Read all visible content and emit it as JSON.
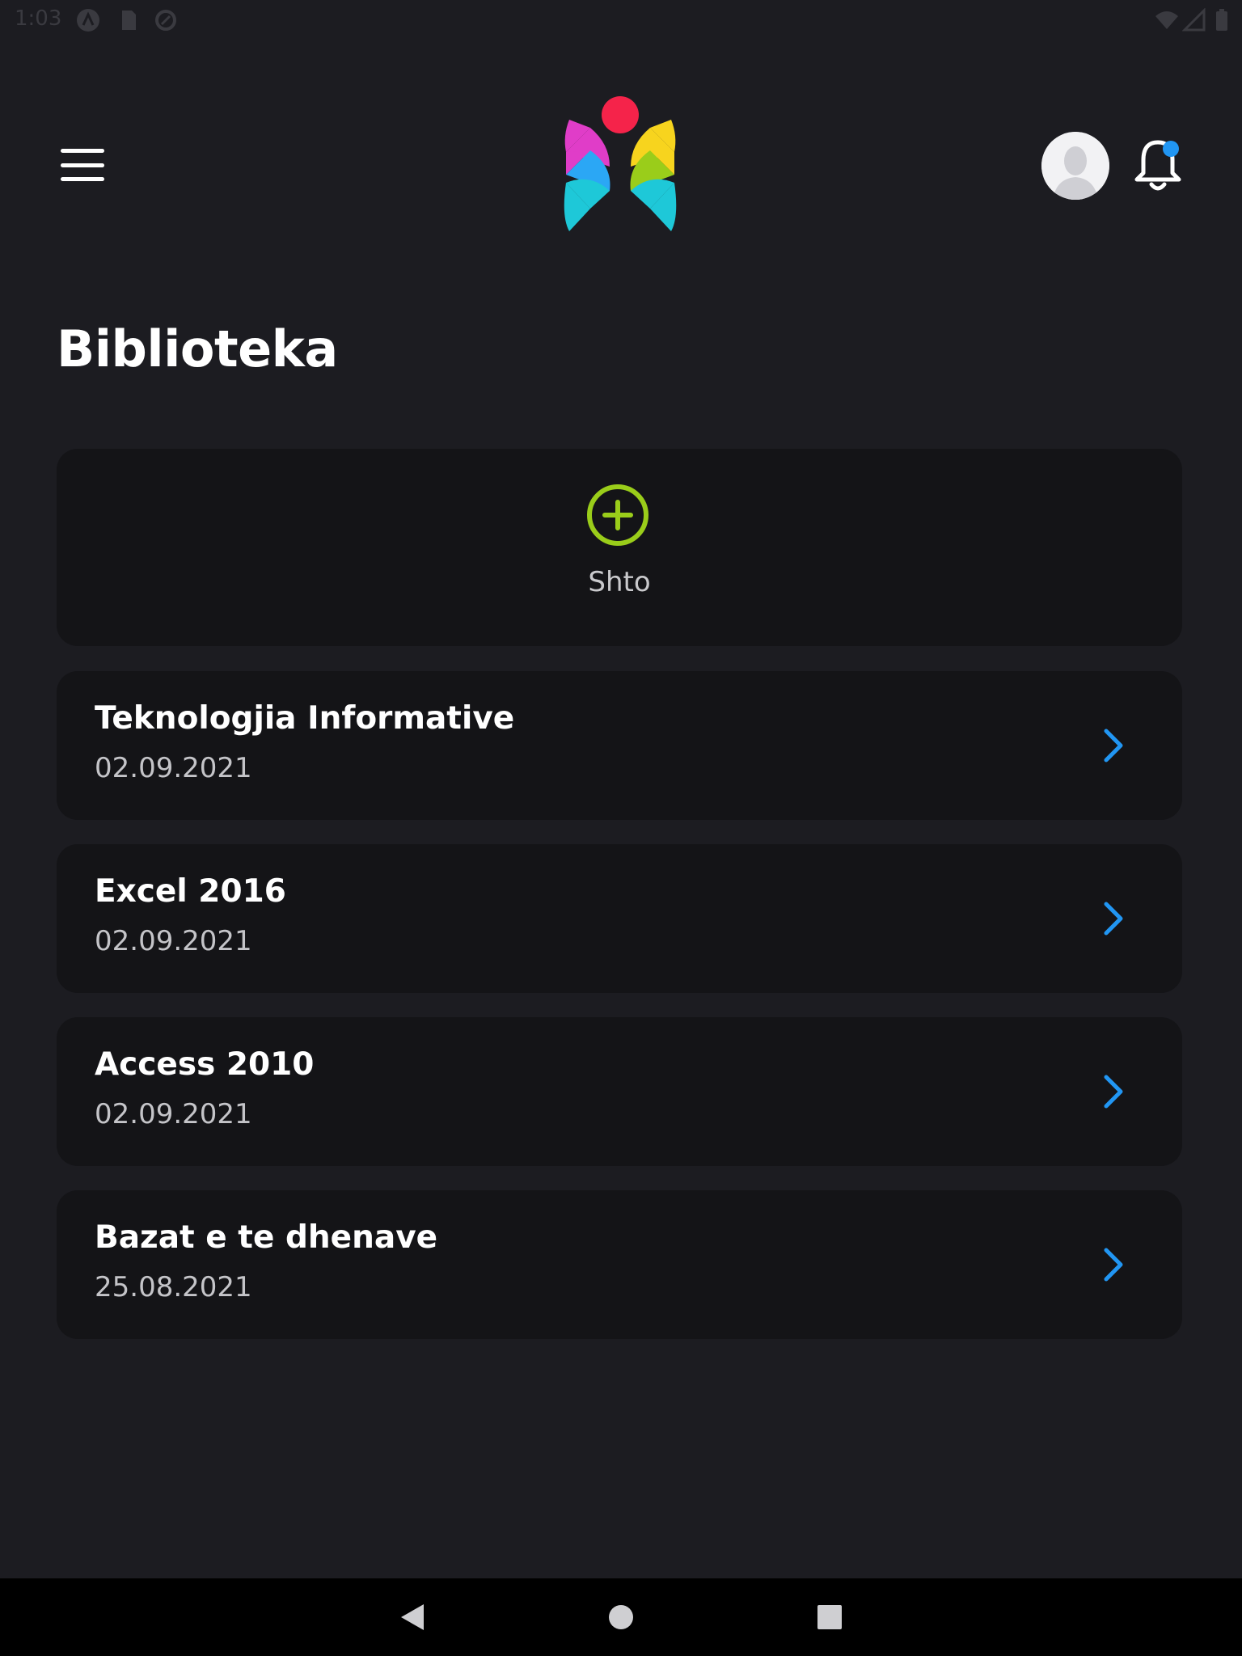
{
  "status_bar": {
    "time": "1:03",
    "icons": [
      "android-debug-icon",
      "sd-card-icon",
      "sync-icon",
      "wifi-icon",
      "signal-icon",
      "battery-icon"
    ]
  },
  "header": {
    "menu_icon": "hamburger-menu-icon",
    "logo": "app-logo",
    "avatar_icon": "user-avatar-icon",
    "notification_icon": "bell-icon",
    "notification_badge_color": "#2196f3"
  },
  "page": {
    "title": "Biblioteka"
  },
  "add_card": {
    "label": "Shto",
    "icon": "plus-circle-icon",
    "icon_color": "#9acd1a"
  },
  "items": [
    {
      "title": "Teknologjia Informative",
      "date": "02.09.2021"
    },
    {
      "title": "Excel 2016",
      "date": "02.09.2021"
    },
    {
      "title": "Access 2010",
      "date": "02.09.2021"
    },
    {
      "title": "Bazat e te dhenave",
      "date": "25.08.2021"
    }
  ],
  "colors": {
    "background": "#1c1c21",
    "card": "#141417",
    "accent_blue": "#2196f3",
    "accent_green": "#9acd1a"
  },
  "nav": {
    "back_icon": "back-triangle-icon",
    "home_icon": "home-circle-icon",
    "recents_icon": "recents-square-icon"
  }
}
